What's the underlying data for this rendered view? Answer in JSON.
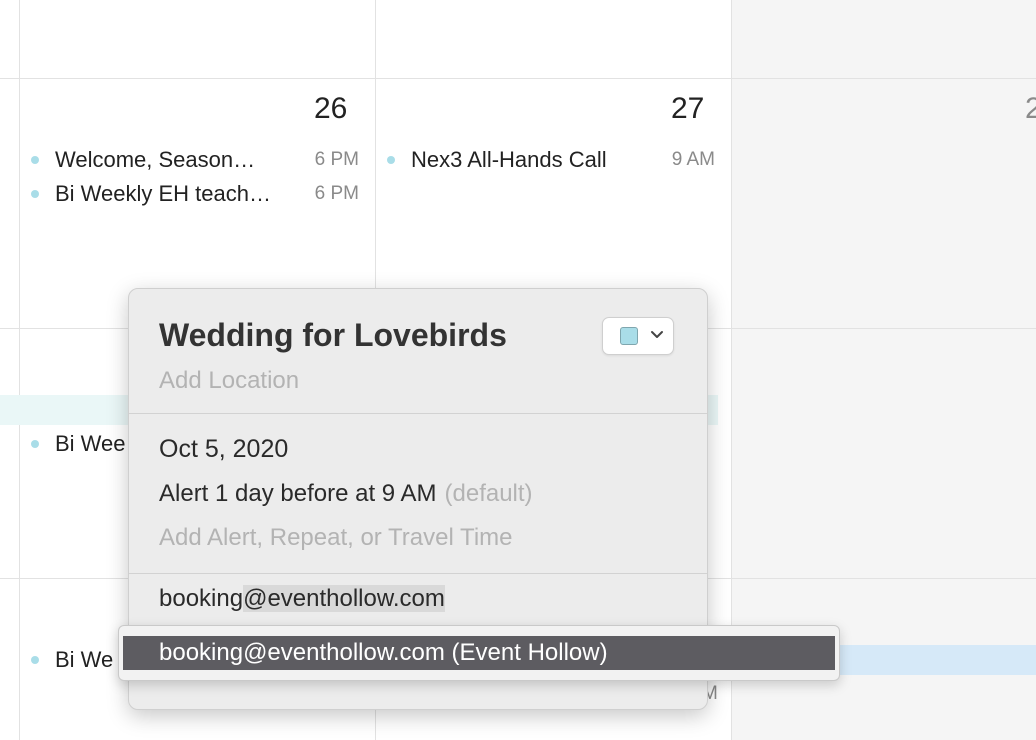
{
  "calendar": {
    "day_numbers": {
      "d26": "26",
      "d27": "27",
      "d28_partial": "2"
    },
    "events": {
      "e1_title": "Welcome, Season…",
      "e1_time": "6 PM",
      "e2_title": "Bi Weekly EH teach…",
      "e2_time": "6 PM",
      "e3_title": "Nex3 All-Hands Call",
      "e3_time": "9 AM",
      "e4_title": "Bi Wee",
      "e5_title": "Bi We",
      "e6_time_partial": "M"
    },
    "colors": {
      "event_dot": "#a9dde8",
      "allday_teal": "#eaf7f7",
      "allday_blue": "#d6e9f8"
    }
  },
  "popover": {
    "title": "Wedding for Lovebirds",
    "location_placeholder": "Add Location",
    "color_swatch": "#a9dde8",
    "date": "Oct 5, 2020",
    "alert": "Alert 1 day before at 9 AM",
    "alert_default": "(default)",
    "add_alert_placeholder": "Add Alert, Repeat, or Travel Time",
    "invitee_prefix": "booking",
    "invitee_selected": "@eventhollow.com"
  },
  "autocomplete": {
    "suggestion": "booking@eventhollow.com (Event Hollow)"
  }
}
